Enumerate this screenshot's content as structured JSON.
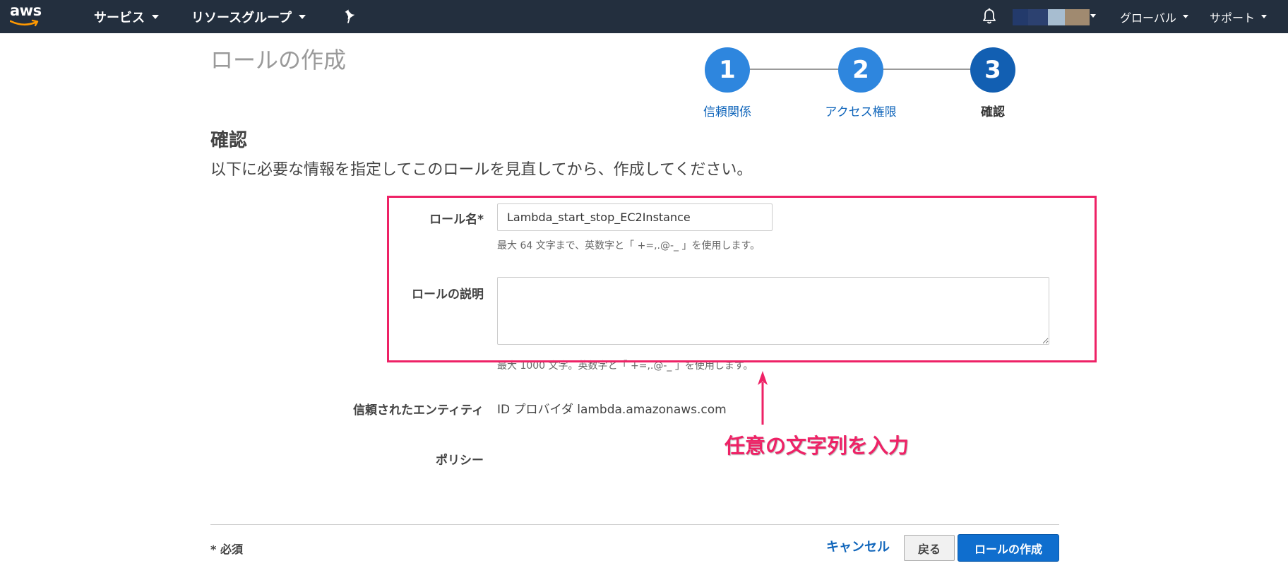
{
  "nav": {
    "logo": "aws",
    "services": "サービス",
    "resource_groups": "リソースグループ",
    "region": "グローバル",
    "support": "サポート",
    "account_colors": [
      "#233a6b",
      "#2c4170",
      "#a7bdd0",
      "#a08a70"
    ]
  },
  "page": {
    "title": "ロールの作成"
  },
  "steps": [
    {
      "number": "1",
      "label": "信頼関係",
      "state": "complete"
    },
    {
      "number": "2",
      "label": "アクセス権限",
      "state": "complete"
    },
    {
      "number": "3",
      "label": "確認",
      "state": "current"
    }
  ],
  "review": {
    "title": "確認",
    "description": "以下に必要な情報を指定してこのロールを見直してから、作成してください。"
  },
  "form": {
    "role_name_label": "ロール名*",
    "role_name_value": "Lambda_start_stop_EC2Instance",
    "role_name_hint": "最大 64 文字まで、英数字と「 +=,.@-_ 」を使用します。",
    "role_desc_label": "ロールの説明",
    "role_desc_value": "",
    "role_desc_hint": "最大 1000 文字。英数字と「 +=,.@-_ 」を使用します。",
    "trusted_entity_label": "信頼されたエンティティ",
    "trusted_entity_value": "ID プロバイダ lambda.amazonaws.com",
    "policy_label": "ポリシー"
  },
  "annotation": {
    "text": "任意の文字列を入力",
    "color": "#ee2266"
  },
  "footer": {
    "required_note": "* 必須",
    "cancel": "キャンセル",
    "back": "戻る",
    "create": "ロールの作成"
  },
  "colors": {
    "nav_bg": "#232f3e",
    "step_complete": "#2e86de",
    "step_current": "#125fb2",
    "link": "#1166bb",
    "primary_button": "#0f6ece"
  }
}
